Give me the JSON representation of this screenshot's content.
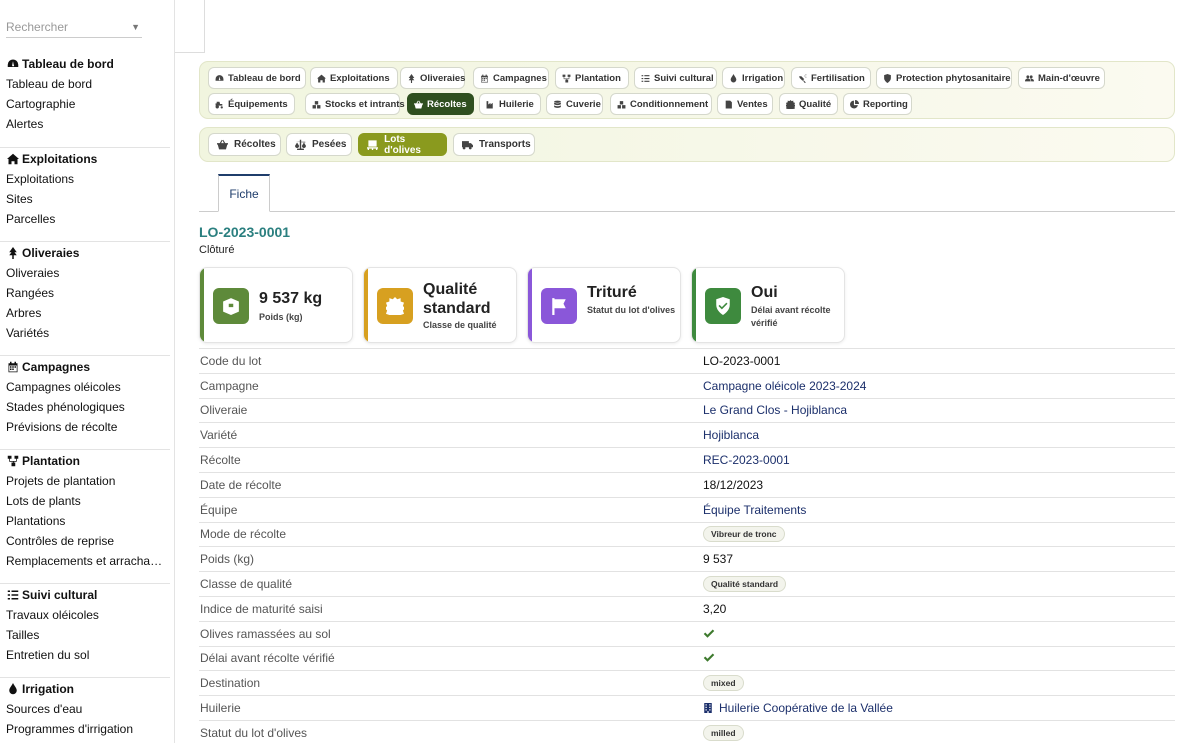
{
  "search": {
    "placeholder": "Rechercher"
  },
  "sidebar": {
    "sections": [
      {
        "title": "Tableau de bord",
        "icon": "dashboard-icon",
        "items": [
          "Tableau de bord",
          "Cartographie",
          "Alertes"
        ]
      },
      {
        "title": "Exploitations",
        "icon": "home-icon",
        "items": [
          "Exploitations",
          "Sites",
          "Parcelles"
        ]
      },
      {
        "title": "Oliveraies",
        "icon": "tree-icon",
        "items": [
          "Oliveraies",
          "Rangées",
          "Arbres",
          "Variétés"
        ]
      },
      {
        "title": "Campagnes",
        "icon": "calendar-icon",
        "items": [
          "Campagnes oléicoles",
          "Stades phénologiques",
          "Prévisions de récolte"
        ]
      },
      {
        "title": "Plantation",
        "icon": "sitemap-icon",
        "items": [
          "Projets de plantation",
          "Lots de plants",
          "Plantations",
          "Contrôles de reprise",
          "Remplacements et arrachages"
        ]
      },
      {
        "title": "Suivi cultural",
        "icon": "list-check-icon",
        "items": [
          "Travaux oléicoles",
          "Tailles",
          "Entretien du sol"
        ]
      },
      {
        "title": "Irrigation",
        "icon": "droplet-icon",
        "items": [
          "Sources d'eau",
          "Programmes d'irrigation"
        ]
      }
    ]
  },
  "nav_primary": [
    {
      "label": "Tableau de bord",
      "icon": "dashboard-icon"
    },
    {
      "label": "Exploitations",
      "icon": "home-icon"
    },
    {
      "label": "Oliveraies",
      "icon": "tree-icon"
    },
    {
      "label": "Campagnes",
      "icon": "calendar-icon"
    },
    {
      "label": "Plantation",
      "icon": "sitemap-icon"
    },
    {
      "label": "Suivi cultural",
      "icon": "list-check-icon"
    },
    {
      "label": "Irrigation",
      "icon": "droplet-icon"
    },
    {
      "label": "Fertilisation",
      "icon": "spray-icon"
    },
    {
      "label": "Protection phytosanitaire",
      "icon": "shield-icon"
    },
    {
      "label": "Main-d'œuvre",
      "icon": "users-icon"
    },
    {
      "label": "Équipements",
      "icon": "tractor-icon"
    },
    {
      "label": "Stocks et intrants",
      "icon": "boxes-icon"
    },
    {
      "label": "Récoltes",
      "icon": "basket-icon",
      "active": true
    },
    {
      "label": "Huilerie",
      "icon": "industry-icon"
    },
    {
      "label": "Cuverie",
      "icon": "database-icon"
    },
    {
      "label": "Conditionnement",
      "icon": "boxes-icon"
    },
    {
      "label": "Ventes",
      "icon": "invoice-icon"
    },
    {
      "label": "Qualité",
      "icon": "certificate-icon"
    },
    {
      "label": "Reporting",
      "icon": "chart-pie-icon"
    }
  ],
  "nav_secondary": [
    {
      "label": "Récoltes",
      "icon": "basket-icon"
    },
    {
      "label": "Pesées",
      "icon": "scale-icon"
    },
    {
      "label": "Lots d'olives",
      "icon": "pallet-icon",
      "active": true
    },
    {
      "label": "Transports",
      "icon": "truck-icon"
    }
  ],
  "tabs": {
    "fiche": "Fiche"
  },
  "lot": {
    "code": "LO-2023-0001",
    "status": "Clôturé"
  },
  "cards": [
    {
      "value": "9 537 kg",
      "label": "Poids (kg)",
      "color": "#5e8a3a",
      "icon": "box-icon"
    },
    {
      "value": "Qualité standard",
      "label": "Classe de qualité",
      "color": "#d7a020",
      "icon": "certificate-icon"
    },
    {
      "value": "Trituré",
      "label": "Statut du lot d'olives",
      "color": "#8a57d9",
      "icon": "flag-icon"
    },
    {
      "value": "Oui",
      "label": "Délai avant récolte vérifié",
      "color": "#3e8a3e",
      "icon": "shield-check-icon"
    }
  ],
  "details": [
    {
      "label": "Code du lot",
      "value": "LO-2023-0001",
      "type": "text"
    },
    {
      "label": "Campagne",
      "value": "Campagne oléicole 2023-2024",
      "type": "link"
    },
    {
      "label": "Oliveraie",
      "value": "Le Grand Clos - Hojiblanca",
      "type": "link"
    },
    {
      "label": "Variété",
      "value": "Hojiblanca",
      "type": "link"
    },
    {
      "label": "Récolte",
      "value": "REC-2023-0001",
      "type": "link"
    },
    {
      "label": "Date de récolte",
      "value": "18/12/2023",
      "type": "text"
    },
    {
      "label": "Équipe",
      "value": "Équipe Traitements",
      "type": "link"
    },
    {
      "label": "Mode de récolte",
      "value": "Vibreur de tronc",
      "type": "badge"
    },
    {
      "label": "Poids (kg)",
      "value": "9 537",
      "type": "text"
    },
    {
      "label": "Classe de qualité",
      "value": "Qualité standard",
      "type": "badge"
    },
    {
      "label": "Indice de maturité saisi",
      "value": "3,20",
      "type": "text"
    },
    {
      "label": "Olives ramassées au sol",
      "value": "",
      "type": "check"
    },
    {
      "label": "Délai avant récolte vérifié",
      "value": "",
      "type": "check"
    },
    {
      "label": "Destination",
      "value": "mixed",
      "type": "badge"
    },
    {
      "label": "Huilerie",
      "value": "Huilerie Coopérative de la Vallée",
      "type": "link-icon"
    },
    {
      "label": "Statut du lot d'olives",
      "value": "milled",
      "type": "badge"
    }
  ]
}
